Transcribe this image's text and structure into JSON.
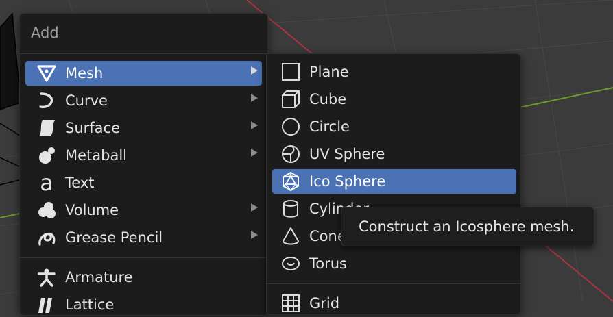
{
  "add_menu": {
    "title": "Add",
    "items": [
      {
        "label": "Mesh",
        "icon": "mesh-icon",
        "submenu": true,
        "active": true
      },
      {
        "label": "Curve",
        "icon": "curve-icon",
        "submenu": true
      },
      {
        "label": "Surface",
        "icon": "surface-icon",
        "submenu": true
      },
      {
        "label": "Metaball",
        "icon": "metaball-icon",
        "submenu": true
      },
      {
        "label": "Text",
        "icon": "text-icon",
        "submenu": false
      },
      {
        "label": "Volume",
        "icon": "volume-icon",
        "submenu": true
      },
      {
        "label": "Grease Pencil",
        "icon": "grease-pencil-icon",
        "submenu": true
      },
      {
        "label": "Armature",
        "icon": "armature-icon",
        "submenu": false
      },
      {
        "label": "Lattice",
        "icon": "lattice-icon",
        "submenu": false
      }
    ]
  },
  "mesh_menu": {
    "items": [
      {
        "label": "Plane",
        "icon": "plane-icon"
      },
      {
        "label": "Cube",
        "icon": "cube-icon"
      },
      {
        "label": "Circle",
        "icon": "circle-icon"
      },
      {
        "label": "UV Sphere",
        "icon": "uv-sphere-icon"
      },
      {
        "label": "Ico Sphere",
        "icon": "ico-sphere-icon",
        "active": true
      },
      {
        "label": "Cylinder",
        "icon": "cylinder-icon"
      },
      {
        "label": "Cone",
        "icon": "cone-icon"
      },
      {
        "label": "Torus",
        "icon": "torus-icon"
      },
      {
        "label": "Grid",
        "icon": "grid-icon"
      }
    ]
  },
  "tooltip": {
    "text": "Construct an Icosphere mesh."
  },
  "colors": {
    "menu_bg": "#1c1c1c",
    "highlight": "#4a72b5",
    "viewport_bg": "#3b3b3b",
    "x_axis": "#a8343f",
    "y_axis": "#6f9a2c"
  }
}
